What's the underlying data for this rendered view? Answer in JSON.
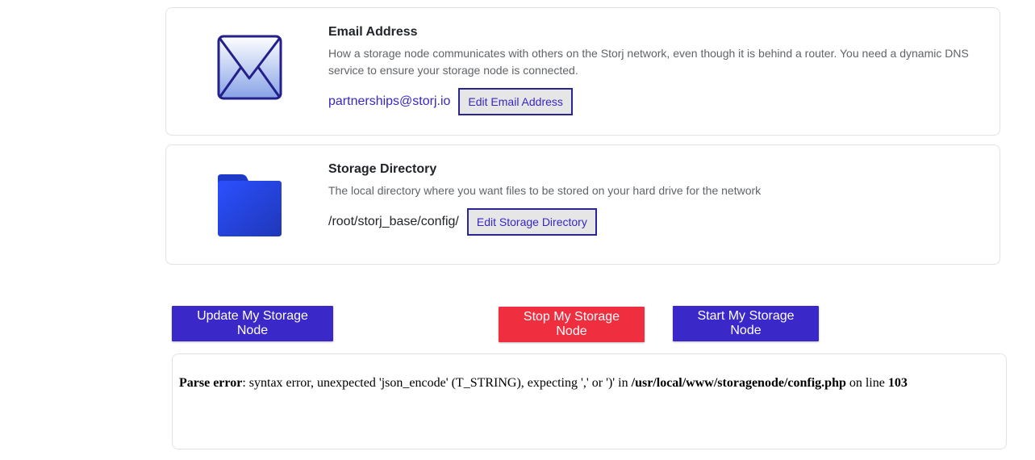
{
  "email_card": {
    "title": "Email Address",
    "description": "How a storage node communicates with others on the Storj network, even though it is behind a router. You need a dynamic DNS service to ensure your storage node is connected.",
    "value": "partnerships@storj.io",
    "edit_label": "Edit Email Address",
    "icon": "envelope-icon"
  },
  "storage_card": {
    "title": "Storage Directory",
    "description": "The local directory where you want files to be stored on your hard drive for the network",
    "value": "/root/storj_base/config/",
    "edit_label": "Edit Storage Directory",
    "icon": "folder-icon"
  },
  "actions": {
    "update_label": "Update My Storage Node",
    "stop_label": "Stop My Storage Node",
    "start_label": "Start My Storage Node"
  },
  "error": {
    "label": "Parse error",
    "message": ": syntax error, unexpected 'json_encode' (T_STRING), expecting ',' or ')' in ",
    "file": "/usr/local/www/storagenode/config.php",
    "line_text": " on line ",
    "line_number": "103"
  },
  "colors": {
    "primary": "#3a28c8",
    "danger": "#ef2e40",
    "link": "#3727c4"
  }
}
